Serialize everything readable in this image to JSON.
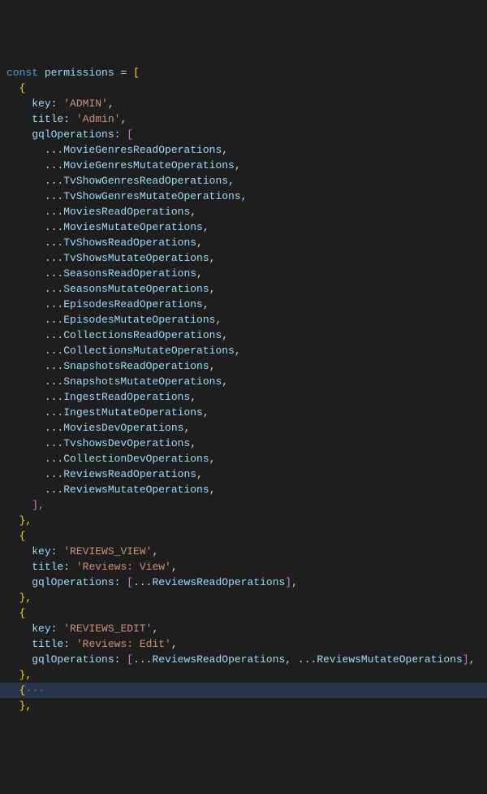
{
  "code": {
    "decl": {
      "kw": "const",
      "name": "permissions",
      "eq": " = ",
      "open": "["
    },
    "objOpen": "{",
    "objClose": "},",
    "arrClose": "],",
    "obj1": {
      "key": {
        "prop": "key",
        "val": "'ADMIN'",
        "sep": ": ",
        "end": ","
      },
      "title": {
        "prop": "title",
        "val": "'Admin'",
        "sep": ": ",
        "end": ","
      },
      "gql": {
        "prop": "gqlOperations",
        "sep": ": ",
        "open": "["
      },
      "items": [
        "MovieGenresReadOperations",
        "MovieGenresMutateOperations",
        "TvShowGenresReadOperations",
        "TvShowGenresMutateOperations",
        "MoviesReadOperations",
        "MoviesMutateOperations",
        "TvShowsReadOperations",
        "TvShowsMutateOperations",
        "SeasonsReadOperations",
        "SeasonsMutateOperations",
        "EpisodesReadOperations",
        "EpisodesMutateOperations",
        "CollectionsReadOperations",
        "CollectionsMutateOperations",
        "SnapshotsReadOperations",
        "SnapshotsMutateOperations",
        "IngestReadOperations",
        "IngestMutateOperations",
        "MoviesDevOperations",
        "TvshowsDevOperations",
        "CollectionDevOperations",
        "ReviewsReadOperations",
        "ReviewsMutateOperations"
      ],
      "spread": "...",
      "itemEnd": ","
    },
    "obj2": {
      "key": {
        "prop": "key",
        "val": "'REVIEWS_VIEW'",
        "sep": ": ",
        "end": ","
      },
      "title": {
        "prop": "title",
        "val": "'Reviews: View'",
        "sep": ": ",
        "end": ","
      },
      "gql": {
        "prop": "gqlOperations",
        "sep": ": "
      },
      "open": "[",
      "close": "]",
      "end": ",",
      "items": [
        "ReviewsReadOperations"
      ],
      "spread": "..."
    },
    "obj3": {
      "key": {
        "prop": "key",
        "val": "'REVIEWS_EDIT'",
        "sep": ": ",
        "end": ","
      },
      "title": {
        "prop": "title",
        "val": "'Reviews: Edit'",
        "sep": ": ",
        "end": ","
      },
      "gql": {
        "prop": "gqlOperations",
        "sep": ": "
      },
      "open": "[",
      "close": "]",
      "end": ",",
      "items": [
        "ReviewsReadOperations",
        "ReviewsMutateOperations"
      ],
      "spread": "...",
      "listSep": ", "
    },
    "folded": {
      "open": "{",
      "dots": "···"
    },
    "foldedClose": "},"
  },
  "indent": {
    "i1": "  ",
    "i2": "    ",
    "i3": "      "
  }
}
